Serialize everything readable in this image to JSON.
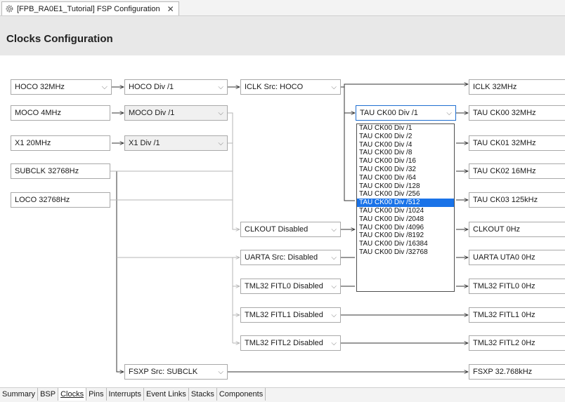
{
  "editor_tab": {
    "label": "[FPB_RA0E1_Tutorial] FSP Configuration",
    "close": "✕"
  },
  "page_title": "Clocks Configuration",
  "sources": {
    "hoco": "HOCO 32MHz",
    "moco": "MOCO 4MHz",
    "x1": "X1 20MHz",
    "subclk": "SUBCLK 32768Hz",
    "loco": "LOCO 32768Hz"
  },
  "dividers": {
    "hoco_div": "HOCO Div /1",
    "moco_div": "MOCO Div /1",
    "x1_div": "X1 Div /1"
  },
  "selectors": {
    "iclk_src": "ICLK Src: HOCO",
    "tau_ck00_div": "TAU CK00 Div /1",
    "clkout": "CLKOUT Disabled",
    "uarta_src": "UARTA Src: Disabled",
    "tml32_fitl0": "TML32 FITL0 Disabled",
    "tml32_fitl1": "TML32 FITL1 Disabled",
    "tml32_fitl2": "TML32 FITL2 Disabled",
    "fsxp_src": "FSXP Src: SUBCLK"
  },
  "outputs": {
    "iclk": "ICLK 32MHz",
    "tau_ck00": "TAU CK00 32MHz",
    "tau_ck01": "TAU CK01 32MHz",
    "tau_ck02": "TAU CK02 16MHz",
    "tau_ck03": "TAU CK03 125kHz",
    "clkout": "CLKOUT 0Hz",
    "uarta": "UARTA UTA0 0Hz",
    "tml32_fitl0": "TML32 FITL0 0Hz",
    "tml32_fitl1": "TML32 FITL1 0Hz",
    "tml32_fitl2": "TML32 FITL2 0Hz",
    "fsxp": "FSXP 32.768kHz"
  },
  "dropdown": {
    "options": [
      "TAU CK00 Div /1",
      "TAU CK00 Div /2",
      "TAU CK00 Div /4",
      "TAU CK00 Div /8",
      "TAU CK00 Div /16",
      "TAU CK00 Div /32",
      "TAU CK00 Div /64",
      "TAU CK00 Div /128",
      "TAU CK00 Div /256",
      "TAU CK00 Div /512",
      "TAU CK00 Div /1024",
      "TAU CK00 Div /2048",
      "TAU CK00 Div /4096",
      "TAU CK00 Div /8192",
      "TAU CK00 Div /16384",
      "TAU CK00 Div /32768"
    ],
    "highlighted": "TAU CK00 Div /512"
  },
  "bottom_tabs": [
    "Summary",
    "BSP",
    "Clocks",
    "Pins",
    "Interrupts",
    "Event Links",
    "Stacks",
    "Components"
  ],
  "active_bottom_tab": "Clocks",
  "colors": {
    "header_bg": "#e8e8e8",
    "selection": "#1a73e8",
    "focus_border": "#1f6fd1",
    "wire": "#333333",
    "wire_inactive": "#b5b5b5"
  }
}
